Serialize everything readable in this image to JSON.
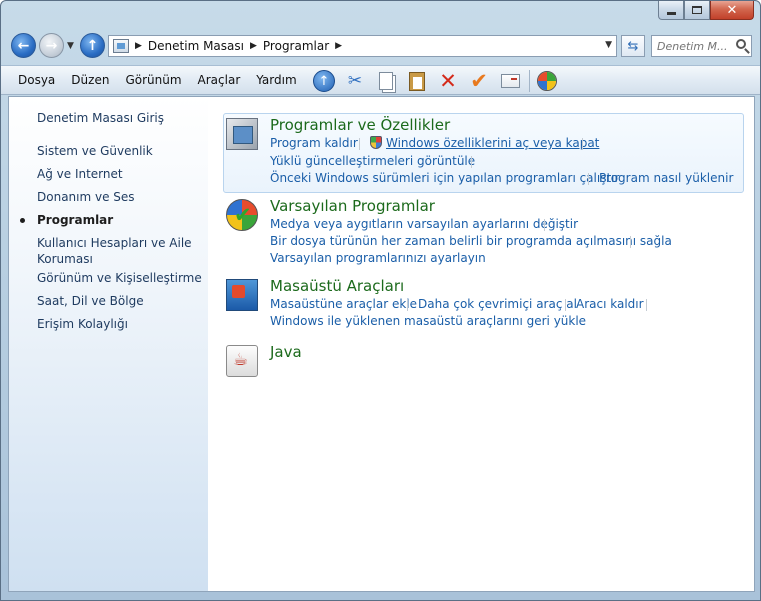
{
  "address": {
    "crumbs": [
      "Denetim Masası",
      "Programlar"
    ]
  },
  "search": {
    "placeholder": "Denetim M..."
  },
  "menu": [
    "Dosya",
    "Düzen",
    "Görünüm",
    "Araçlar",
    "Yardım"
  ],
  "sidebar": {
    "items": [
      "Denetim Masası Giriş",
      "Sistem ve Güvenlik",
      "Ağ ve Internet",
      "Donanım ve Ses",
      "Programlar",
      "Kullanıcı Hesapları ve Aile Koruması",
      "Görünüm ve Kişiselleştirme",
      "Saat, Dil ve Bölge",
      "Erişim Kolaylığı"
    ],
    "active_index": 4
  },
  "categories": {
    "programs": {
      "title": "Programlar ve Özellikler",
      "links": [
        "Program kaldır",
        "Windows özelliklerini aç veya kapat",
        "Yüklü güncelleştirmeleri görüntüle",
        "Önceki Windows sürümleri için yapılan programları çalıştır",
        "Program nasıl yüklenir"
      ]
    },
    "defaults": {
      "title": "Varsayılan Programlar",
      "links": [
        "Medya veya aygıtların varsayılan ayarlarını değiştir",
        "Bir dosya türünün her zaman belirli bir programda açılmasını sağla",
        "Varsayılan programlarınızı ayarlayın"
      ]
    },
    "gadgets": {
      "title": "Masaüstü Araçları",
      "links": [
        "Masaüstüne araçlar ekle",
        "Daha çok çevrimiçi araç al",
        "Aracı kaldır",
        "Windows ile yüklenen masaüstü araçlarını geri yükle"
      ]
    },
    "java": {
      "title": "Java"
    }
  }
}
